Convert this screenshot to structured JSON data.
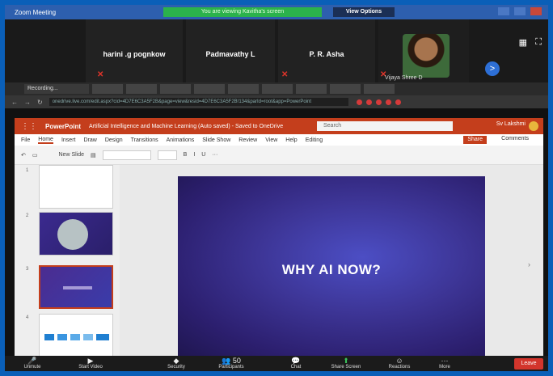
{
  "zoom": {
    "window_title": "Zoom Meeting",
    "banner": "You are viewing Kavitha's screen",
    "view_options": "View Options",
    "participants": [
      {
        "name": "harini .g pognkow",
        "muted": true
      },
      {
        "name": "Padmavathy L",
        "muted": false
      },
      {
        "name": "P. R. Asha",
        "muted": true
      },
      {
        "name": "Vijaya Shree D",
        "muted": true
      }
    ],
    "next_label": ">",
    "gallery_icon": "gallery-view-icon",
    "fullscreen_icon": "fullscreen-icon"
  },
  "browser": {
    "tab_recording": "Recording...",
    "url": "onedrive.live.com/edit.aspx?cid=4D7E6C3A5F2B&page=view&resid=4D7E6C3A5F2B!134&parId=root&app=PowerPoint"
  },
  "ppt": {
    "brand": "PowerPoint",
    "doc_title": "Artificial Intelligence and Machine Learning (Auto saved) - Saved to OneDrive",
    "search_placeholder": "Search",
    "user": "Sv Lakshmi",
    "menu": [
      "File",
      "Home",
      "Insert",
      "Draw",
      "Design",
      "Transitions",
      "Animations",
      "Slide Show",
      "Review",
      "View",
      "Help",
      "Editing"
    ],
    "active_menu": "Home",
    "share_label": "Share",
    "comments_label": "Comments",
    "new_slide_label": "New Slide",
    "slide_numbers": [
      "1",
      "2",
      "3",
      "4"
    ],
    "slide_title": "WHY AI NOW?"
  },
  "controls": {
    "unmute": "Unmute",
    "start_video": "Start Video",
    "security": "Security",
    "participants": "Participants",
    "participants_count": "50",
    "chat": "Chat",
    "share_screen": "Share Screen",
    "reactions": "Reactions",
    "more": "More",
    "leave": "Leave"
  }
}
